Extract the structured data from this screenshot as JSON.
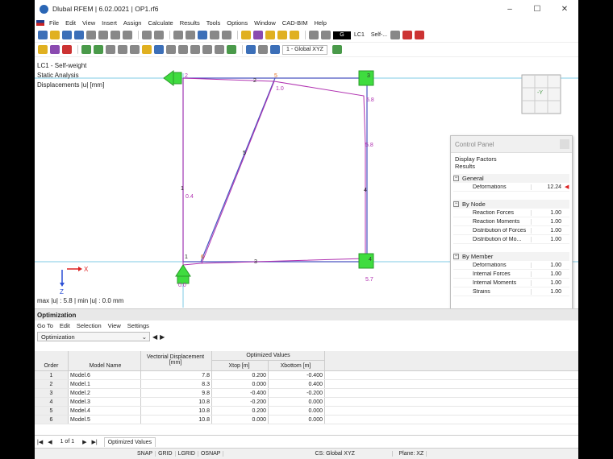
{
  "window": {
    "title": "Dlubal RFEM | 6.02.0021 | OP1.rf6",
    "minimize": "–",
    "maximize": "☐",
    "close": "✕"
  },
  "menu": [
    "File",
    "Edit",
    "View",
    "Insert",
    "Assign",
    "Calculate",
    "Results",
    "Tools",
    "Options",
    "Window",
    "CAD-BIM",
    "Help"
  ],
  "toolbar": {
    "lc_color": "G",
    "lc_label": "LC1",
    "lc_name": "Self-...",
    "cs": "1 - Global XYZ"
  },
  "canvas": {
    "info": [
      "LC1 - Self-weight",
      "Static Analysis",
      "Displacements |u| [mm]"
    ],
    "max_line": "max |u| : 5.8 | min |u| : 0.0 mm",
    "view_cube": "-Y",
    "axis_x": "X",
    "axis_z": "Z",
    "labels": {
      "n2": "2",
      "n1": "1",
      "n3": "3",
      "n4": "4",
      "n5": "5",
      "n6": "6",
      "m2": "2",
      "m3": "3",
      "m4": "4",
      "m5": "5",
      "m1": "1",
      "v10": "1.0",
      "v58a": "5.8",
      "v58b": "5.8",
      "v04": "0.4",
      "v57": "5.7",
      "v00": "0.0"
    }
  },
  "control_panel": {
    "title": "Control Panel",
    "sub1": "Display Factors",
    "sub2": "Results",
    "sections": [
      {
        "name": "General",
        "rows": [
          {
            "label": "Deformations",
            "value": "12.24"
          }
        ]
      },
      {
        "name": "By Node",
        "rows": [
          {
            "label": "Reaction Forces",
            "value": "1.00"
          },
          {
            "label": "Reaction Moments",
            "value": "1.00"
          },
          {
            "label": "Distribution of Forces",
            "value": "1.00"
          },
          {
            "label": "Distribution of Mo...",
            "value": "1.00"
          }
        ]
      },
      {
        "name": "By Member",
        "rows": [
          {
            "label": "Deformations",
            "value": "1.00"
          },
          {
            "label": "Internal Forces",
            "value": "1.00"
          },
          {
            "label": "Internal Moments",
            "value": "1.00"
          },
          {
            "label": "Strains",
            "value": "1.00"
          }
        ]
      }
    ]
  },
  "optimization": {
    "title": "Optimization",
    "menu": [
      "Go To",
      "Edit",
      "Selection",
      "View",
      "Settings"
    ],
    "selector": "Optimization",
    "headers": {
      "order": "Order",
      "model": "Model Name",
      "vd1": "Vectorial Displacement",
      "vd2": "[mm]",
      "group": "Optimized Values",
      "xt": "Xtop [m]",
      "xb": "Xbottom [m]"
    },
    "rows": [
      {
        "order": "1",
        "model": "Model.6",
        "vd": "7.8",
        "xt": "0.200",
        "xb": "-0.400"
      },
      {
        "order": "2",
        "model": "Model.1",
        "vd": "8.3",
        "xt": "0.000",
        "xb": "0.400"
      },
      {
        "order": "3",
        "model": "Model.2",
        "vd": "9.8",
        "xt": "-0.400",
        "xb": "-0.200"
      },
      {
        "order": "4",
        "model": "Model.3",
        "vd": "10.8",
        "xt": "-0.200",
        "xb": "0.000"
      },
      {
        "order": "5",
        "model": "Model.4",
        "vd": "10.8",
        "xt": "0.200",
        "xb": "0.000"
      },
      {
        "order": "6",
        "model": "Model.5",
        "vd": "10.8",
        "xt": "0.000",
        "xb": "0.000"
      }
    ],
    "pager": "1 of 1",
    "tab": "Optimized Values"
  },
  "statusbar": {
    "items": [
      "SNAP",
      "GRID",
      "LGRID",
      "OSNAP"
    ],
    "cs": "CS: Global XYZ",
    "plane": "Plane: XZ"
  }
}
